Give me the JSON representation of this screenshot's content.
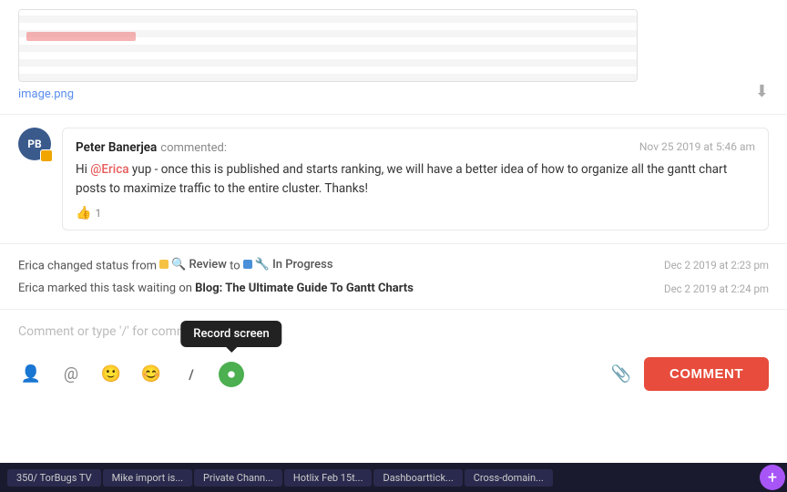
{
  "image": {
    "filename": "image.png",
    "download_tooltip": "Download"
  },
  "comment": {
    "author": "Peter Banerjea",
    "action": "commented:",
    "timestamp": "Nov 25 2019 at 5:46 am",
    "body_prefix": "Hi ",
    "mention": "@Erica",
    "body_suffix": " yup - once this is published and starts ranking, we will have a better idea of how to organize all the gantt chart posts to maximize traffic to the entire cluster. Thanks!",
    "likes": "1"
  },
  "activity": [
    {
      "text_prefix": "Erica changed status from",
      "from_status": "Review",
      "to_label": "to",
      "to_status": "In Progress",
      "timestamp": "Dec 2 2019 at 2:23 pm"
    },
    {
      "text_prefix": "Erica marked this task waiting on",
      "task_name": "Blog: The Ultimate Guide To Gantt Charts",
      "timestamp": "Dec 2 2019 at 2:24 pm"
    }
  ],
  "comment_input": {
    "placeholder": "Comment or type '/' for commands"
  },
  "toolbar": {
    "icons": [
      {
        "name": "person-icon",
        "symbol": "👤"
      },
      {
        "name": "at-icon",
        "symbol": "@"
      },
      {
        "name": "smiley-icon",
        "symbol": "🙂"
      },
      {
        "name": "emoji-icon",
        "symbol": "😊"
      },
      {
        "name": "slash-icon",
        "symbol": "/"
      },
      {
        "name": "record-icon",
        "symbol": "⏺",
        "active": true
      }
    ],
    "record_tooltip": "Record screen",
    "attach_icon": "📎",
    "comment_button": "COMMENT"
  },
  "taskbar": {
    "items": [
      {
        "label": "350/ TorBugs TV",
        "active": false
      },
      {
        "label": "Mike import is...",
        "active": false
      },
      {
        "label": "Private Chann...",
        "active": false
      },
      {
        "label": "Hotlix Feb 15t...",
        "active": false
      },
      {
        "label": "Dashboarttick...",
        "active": false
      },
      {
        "label": "Cross-domain...",
        "active": false
      }
    ],
    "fab_icon": "+"
  }
}
